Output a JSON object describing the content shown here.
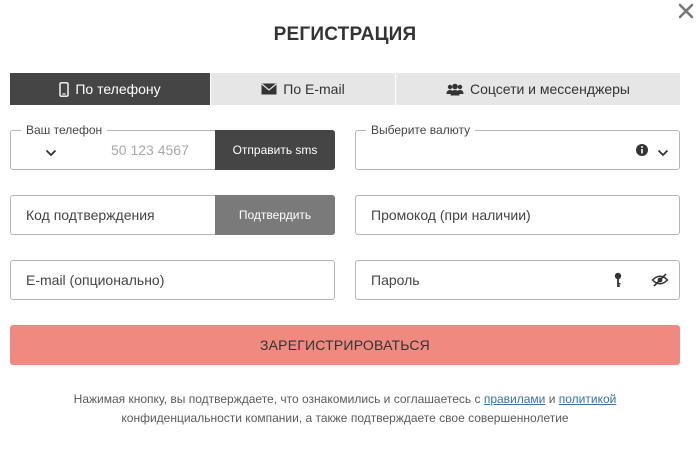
{
  "dialog": {
    "title": "РЕГИСТРАЦИЯ",
    "close_glyph": "×"
  },
  "tabs": [
    {
      "label": "По телефону",
      "icon": "phone-icon",
      "active": true
    },
    {
      "label": "По E-mail",
      "icon": "envelope-icon",
      "active": false
    },
    {
      "label": "Соцсети и мессенджеры",
      "icon": "users-icon",
      "active": false
    }
  ],
  "phone": {
    "label": "Ваш телефон",
    "placeholder": "50 123 4567",
    "sms_button": "Отправить sms"
  },
  "currency": {
    "label": "Выберите валюту",
    "value": ""
  },
  "confirmation": {
    "placeholder": "Код подтверждения",
    "button": "Подтвердить"
  },
  "promo": {
    "placeholder": "Промокод (при наличии)"
  },
  "email": {
    "placeholder": "E-mail (опционально)"
  },
  "password": {
    "placeholder": "Пароль"
  },
  "register_button": "ЗАРЕГИСТРИРОВАТЬСЯ",
  "disclaimer": {
    "part1": "Нажимая кнопку, вы подтверждаете, что ознакомились и соглашаетесь с ",
    "rules_link": "правилами",
    "and": " и ",
    "policy_link": "политикой",
    "part2": "конфиденциальности компании, а также подтверждаете свое совершеннолетие"
  },
  "colors": {
    "active_tab": "#454545",
    "inactive_tab": "#e6e6e6",
    "register_button": "#f08a80",
    "link": "#3a6fa8"
  }
}
